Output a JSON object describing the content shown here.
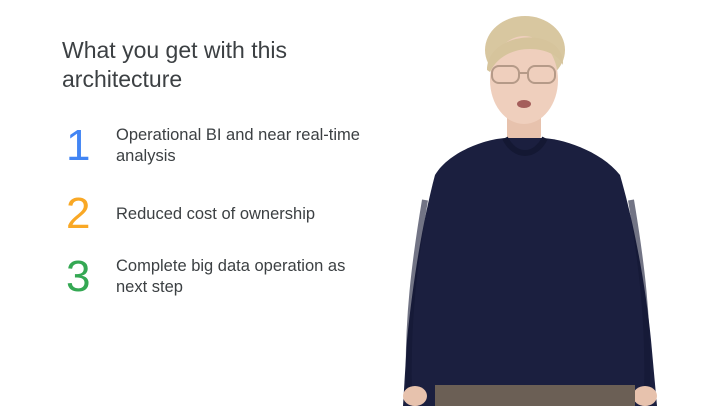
{
  "slide": {
    "title": "What you get with this architecture",
    "items": [
      {
        "number": "1",
        "text": "Operational BI and near real-time analysis",
        "color": "#4285f4"
      },
      {
        "number": "2",
        "text": "Reduced cost of ownership",
        "color": "#f9a825"
      },
      {
        "number": "3",
        "text": "Complete big data operation as next step",
        "color": "#34a853"
      }
    ]
  },
  "presenter": {
    "icon": "presenter-person"
  }
}
